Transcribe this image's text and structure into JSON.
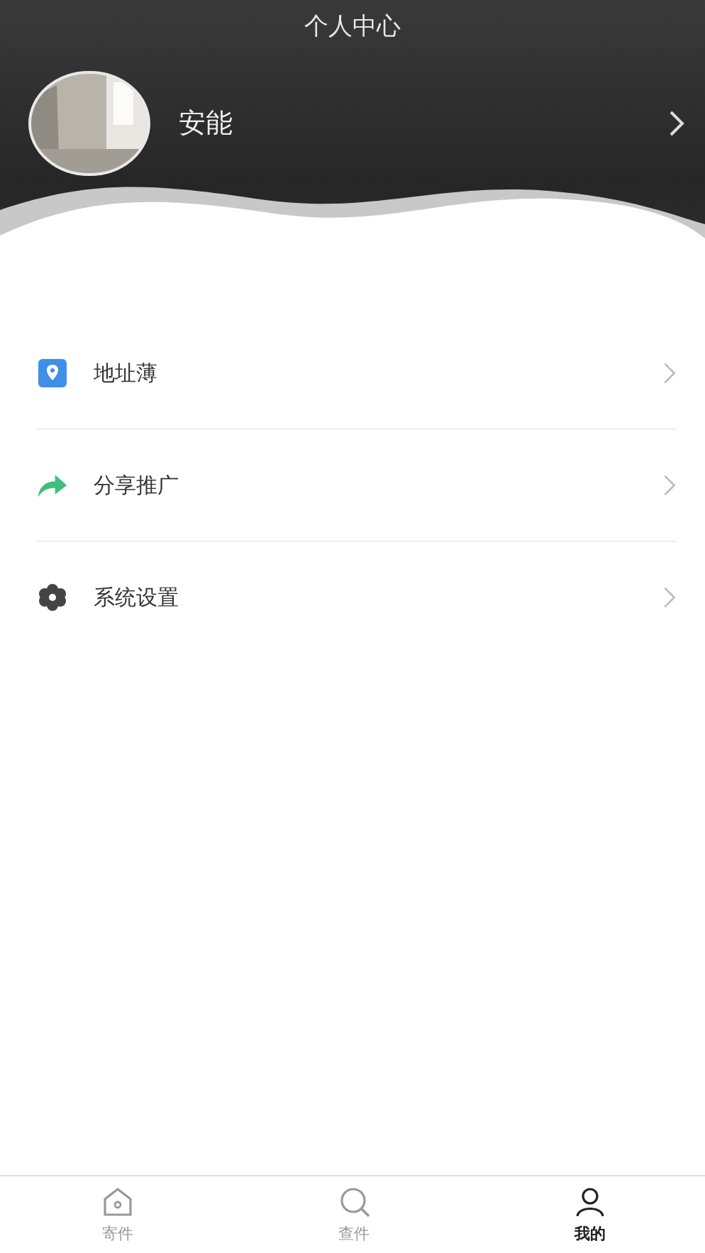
{
  "header": {
    "title": "个人中心"
  },
  "profile": {
    "name": "安能"
  },
  "menu": [
    {
      "kind": "address",
      "label": "地址薄"
    },
    {
      "kind": "share",
      "label": "分享推广"
    },
    {
      "kind": "settings",
      "label": "系统设置"
    }
  ],
  "tabs": [
    {
      "kind": "home",
      "label": "寄件",
      "selected": false
    },
    {
      "kind": "search",
      "label": "查件",
      "selected": false
    },
    {
      "kind": "user",
      "label": "我的",
      "selected": true
    }
  ]
}
